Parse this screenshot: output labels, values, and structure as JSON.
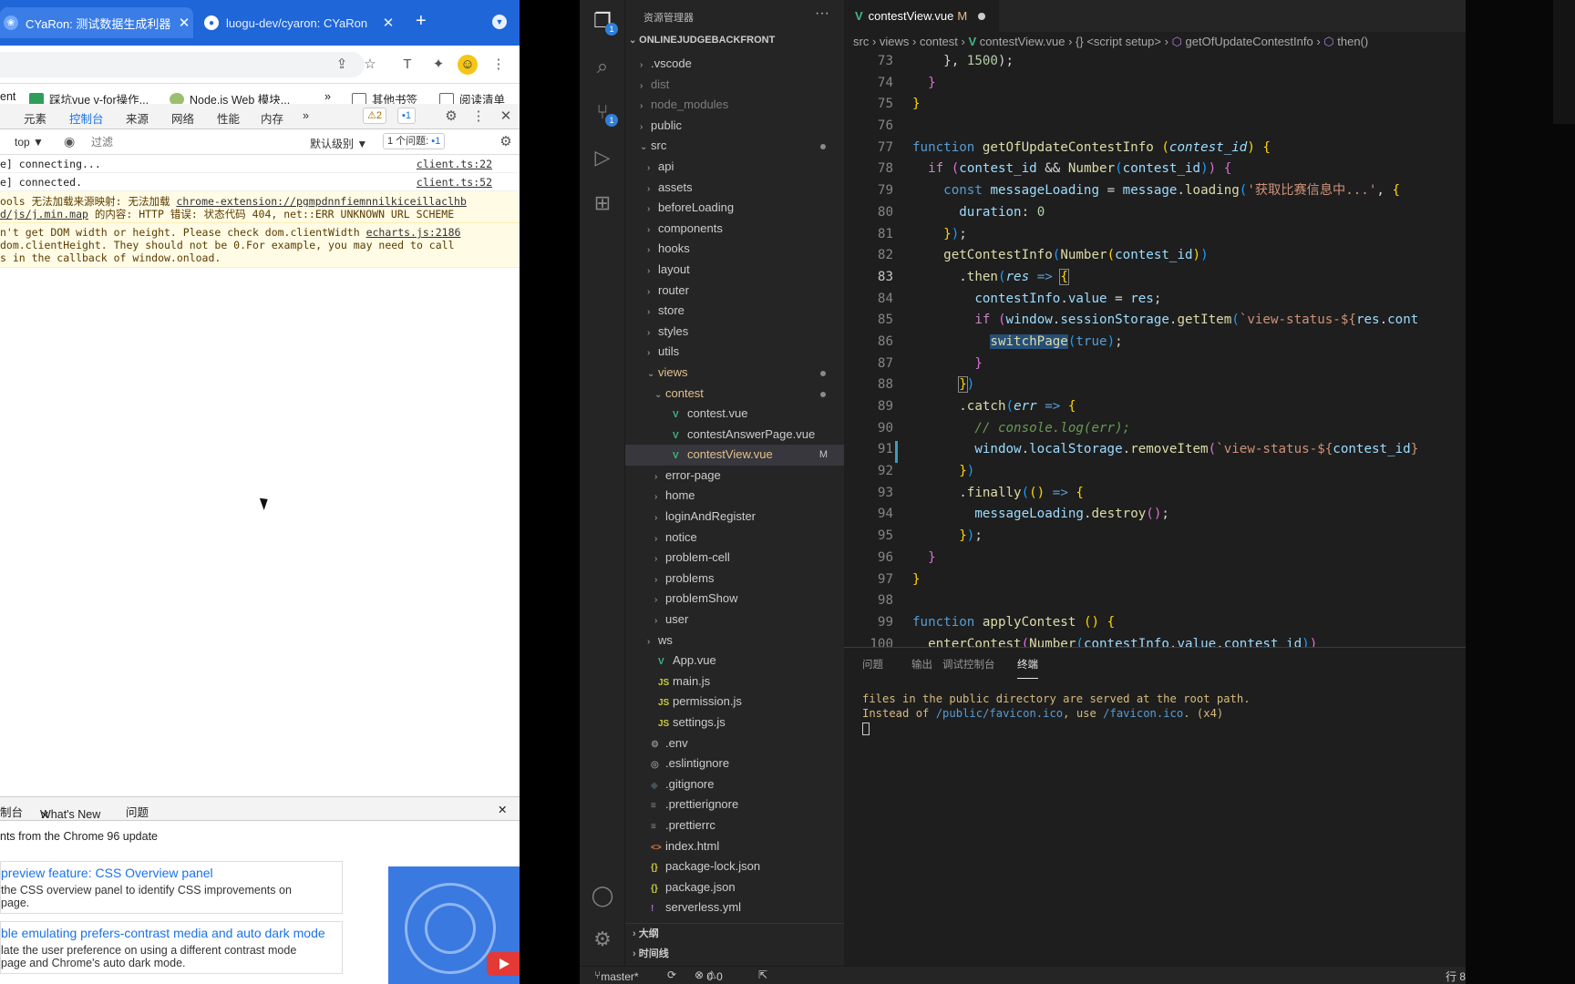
{
  "chrome": {
    "tabs": [
      {
        "title": "CYaRon: 测试数据生成利器"
      },
      {
        "title": "luogu-dev/cyaron: CYaRon"
      }
    ],
    "bookmarks": [
      {
        "label": "ent"
      },
      {
        "label": "踩坑vue v-for操作..."
      },
      {
        "label": "Node.js Web 模块..."
      },
      {
        "label": "»"
      },
      {
        "label": "其他书签"
      },
      {
        "label": "阅读清单"
      }
    ]
  },
  "devtools": {
    "tabs": [
      "元素",
      "控制台",
      "来源",
      "网络",
      "性能",
      "内存",
      "»"
    ],
    "warning_count": "2",
    "info_count": "1",
    "context": "top ▼",
    "filter_placeholder": "过滤",
    "level": "默认级别 ▼",
    "issues": "1 个问题:",
    "issues_count": "1",
    "console": [
      {
        "text": "e] connecting...",
        "src": "client.ts:22"
      },
      {
        "text": "e] connected.",
        "src": "client.ts:52"
      }
    ],
    "warn1": {
      "line1_prefix": "ools 无法加载来源映射: 无法加载 ",
      "line1_link": "chrome-extension://pgmpdnnfiemnnilkiceillaclhb",
      "line2_link": "d/js/j.min.map",
      "line2_rest": " 的内容: HTTP 错误: 状态代码 404, net::ERR_UNKNOWN_URL_SCHEME"
    },
    "warn2": {
      "line1": "n't get DOM width or height. Please check dom.clientWidth ",
      "line1_src": "echarts.js:2186",
      "line2": " dom.clientHeight. They should not be 0.For example, you may need to call",
      "line3": "s in the callback of window.onload."
    },
    "drawer": {
      "tabs": [
        "制台",
        "What's New",
        "问题"
      ],
      "headline": "nts from the Chrome 96 update",
      "cards": [
        {
          "title": " preview feature: CSS Overview panel",
          "desc1": " the CSS overview panel to identify CSS improvements on",
          "desc2": " page."
        },
        {
          "title": "ble emulating prefers-contrast media and auto dark mode",
          "desc1": "late the user preference on using a different contrast mode",
          "desc2": " page and Chrome's auto dark mode."
        }
      ]
    }
  },
  "vscode": {
    "explorer_title": "资源管理器",
    "root": "ONLINEJUDGEBACKFRONT",
    "tree": [
      {
        "label": ".vscode",
        "kind": "folder",
        "depth": 0
      },
      {
        "label": "dist",
        "kind": "folder",
        "depth": 0,
        "dim": true
      },
      {
        "label": "node_modules",
        "kind": "folder",
        "depth": 0,
        "dim": true
      },
      {
        "label": "public",
        "kind": "folder",
        "depth": 0
      },
      {
        "label": "src",
        "kind": "open",
        "depth": 0,
        "dot": true
      },
      {
        "label": "api",
        "kind": "folder",
        "depth": 1
      },
      {
        "label": "assets",
        "kind": "folder",
        "depth": 1
      },
      {
        "label": "beforeLoading",
        "kind": "folder",
        "depth": 1
      },
      {
        "label": "components",
        "kind": "folder",
        "depth": 1
      },
      {
        "label": "hooks",
        "kind": "folder",
        "depth": 1
      },
      {
        "label": "layout",
        "kind": "folder",
        "depth": 1
      },
      {
        "label": "router",
        "kind": "folder",
        "depth": 1
      },
      {
        "label": "store",
        "kind": "folder",
        "depth": 1
      },
      {
        "label": "styles",
        "kind": "folder",
        "depth": 1
      },
      {
        "label": "utils",
        "kind": "folder",
        "depth": 1
      },
      {
        "label": "views",
        "kind": "open",
        "depth": 1,
        "dot": true,
        "modified": true
      },
      {
        "label": "contest",
        "kind": "open",
        "depth": 2,
        "dot": true,
        "modified": true
      },
      {
        "label": "contest.vue",
        "kind": "vue",
        "depth": 3
      },
      {
        "label": "contestAnswerPage.vue",
        "kind": "vue",
        "depth": 3
      },
      {
        "label": "contestView.vue",
        "kind": "vue",
        "depth": 3,
        "selected": true,
        "status": "M",
        "modified": true
      },
      {
        "label": "error-page",
        "kind": "folder",
        "depth": 2
      },
      {
        "label": "home",
        "kind": "folder",
        "depth": 2
      },
      {
        "label": "loginAndRegister",
        "kind": "folder",
        "depth": 2
      },
      {
        "label": "notice",
        "kind": "folder",
        "depth": 2
      },
      {
        "label": "problem-cell",
        "kind": "folder",
        "depth": 2
      },
      {
        "label": "problems",
        "kind": "folder",
        "depth": 2
      },
      {
        "label": "problemShow",
        "kind": "folder",
        "depth": 2
      },
      {
        "label": "user",
        "kind": "folder",
        "depth": 2
      },
      {
        "label": "ws",
        "kind": "folder",
        "depth": 1
      },
      {
        "label": "App.vue",
        "kind": "vue",
        "depth": 1
      },
      {
        "label": "main.js",
        "kind": "js",
        "depth": 1
      },
      {
        "label": "permission.js",
        "kind": "js",
        "depth": 1
      },
      {
        "label": "settings.js",
        "kind": "js",
        "depth": 1
      },
      {
        "label": ".env",
        "kind": "gear",
        "depth": 0
      },
      {
        "label": ".eslintignore",
        "kind": "circle",
        "depth": 0
      },
      {
        "label": ".gitignore",
        "kind": "git",
        "depth": 0
      },
      {
        "label": ".prettierignore",
        "kind": "lines",
        "depth": 0
      },
      {
        "label": ".prettierrc",
        "kind": "lines",
        "depth": 0
      },
      {
        "label": "index.html",
        "kind": "html",
        "depth": 0
      },
      {
        "label": "package-lock.json",
        "kind": "json",
        "depth": 0
      },
      {
        "label": "package.json",
        "kind": "json",
        "depth": 0
      },
      {
        "label": "serverless.yml",
        "kind": "yml",
        "depth": 0
      }
    ],
    "outline": [
      "大纲",
      "时间线"
    ],
    "tab": {
      "name": "contestView.vue",
      "status": "M"
    },
    "breadcrumbs": [
      "src",
      "views",
      "contest",
      "contestView.vue",
      "{} <script setup>",
      "getOfUpdateContestInfo",
      "then()"
    ],
    "line_numbers": [
      "73",
      "74",
      "75",
      "76",
      "77",
      "78",
      "79",
      "80",
      "81",
      "82",
      "83",
      "84",
      "85",
      "86",
      "87",
      "88",
      "89",
      "90",
      "91",
      "92",
      "93",
      "94",
      "95",
      "96",
      "97",
      "98",
      "99",
      "100"
    ],
    "current_line": "83",
    "panel_tabs": [
      "问题",
      "输出",
      "调试控制台",
      "终端"
    ],
    "terminal": {
      "line1": "files in the public directory are served at the root path.",
      "line2a": "Instead of ",
      "line2b": "/public/favicon.ico",
      "line2c": ", use ",
      "line2d": "/favicon.ico",
      "line2e": ". (x4)"
    },
    "status": {
      "branch": "master*",
      "errors": "0",
      "warnings": "0",
      "right": "行 8"
    }
  }
}
